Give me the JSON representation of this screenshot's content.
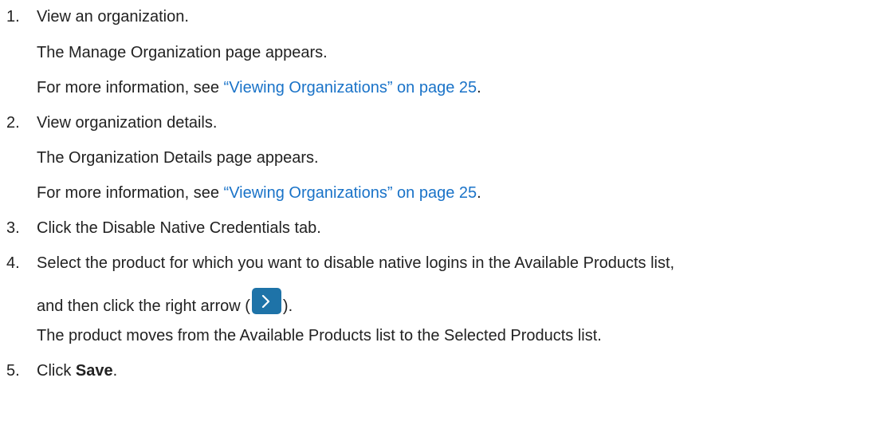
{
  "steps": [
    {
      "number": "1.",
      "instruction": "View an organization.",
      "result": "The Manage Organization page appears.",
      "more_info_prefix": "For more information, see ",
      "more_info_link": "“Viewing Organizations” on page 25",
      "more_info_suffix": "."
    },
    {
      "number": "2.",
      "instruction": "View organization details.",
      "result": "The Organization Details page appears.",
      "more_info_prefix": "For more information, see ",
      "more_info_link": "“Viewing Organizations” on page 25",
      "more_info_suffix": "."
    },
    {
      "number": "3.",
      "instruction": "Click the Disable Native Credentials tab."
    },
    {
      "number": "4.",
      "instruction_line1": "Select the product for which you want to disable native logins in the Available Products list,",
      "instruction_line2_prefix": "and then click the right arrow (",
      "instruction_line2_suffix": ").",
      "arrow_icon": "chevron-right-icon",
      "result": "The product moves from the Available Products list to the Selected Products list."
    },
    {
      "number": "5.",
      "instruction_prefix": "Click ",
      "instruction_bold": "Save",
      "instruction_suffix": "."
    }
  ],
  "colors": {
    "text": "#222222",
    "link": "#1a73c8",
    "arrow_button": "#1e73a8"
  }
}
